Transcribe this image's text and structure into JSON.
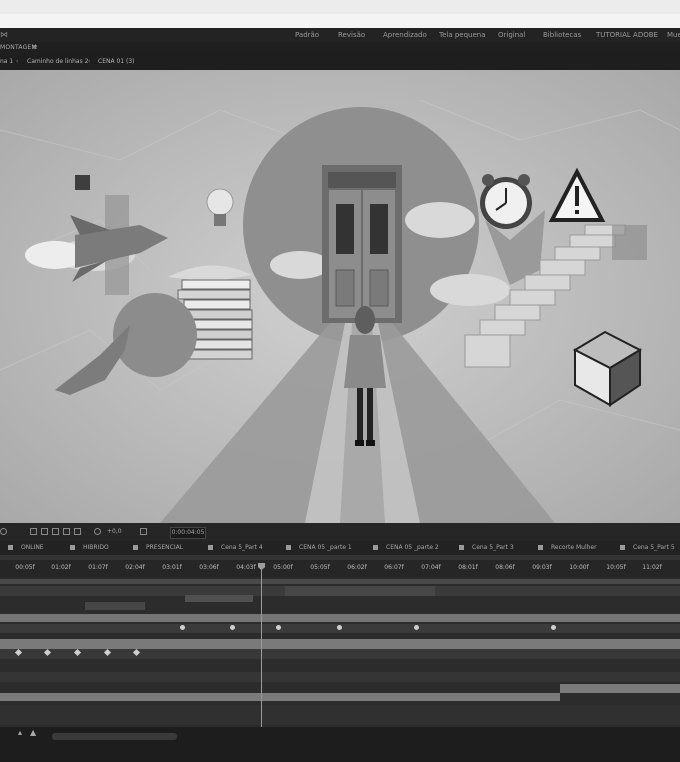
{
  "workspace": {
    "items": [
      "Padrão",
      "Revisão",
      "Aprendizado",
      "Tela pequena",
      "Original",
      "Bibliotecas",
      "TUTORIAL ADOBE",
      "Mue"
    ]
  },
  "panel": {
    "title": "MONTAGEM",
    "menu_icon": "hamburger-icon"
  },
  "breadcrumbs": [
    "na 1",
    "Caminho de linhas 2",
    "CENA 01 (3)"
  ],
  "viewer": {
    "scene": "collage-woman-walking-to-door"
  },
  "toolbar": {
    "exposure": "+0,0",
    "timecode": "0:00:04:05"
  },
  "tabs": [
    "ONLINE",
    "HIBRIDO",
    "PRESENCIAL",
    "Cena 5_Part 4",
    "CENA 05 _parte 1",
    "CENA 05 _parte 2",
    "Cena 5_Part 3",
    "Recorte Mulher",
    "Cena 5_Part 5"
  ],
  "ruler": {
    "ticks": [
      "00:05f",
      "01:02f",
      "01:07f",
      "02:04f",
      "03:01f",
      "03:06f",
      "04:03f",
      "05:00f",
      "05:05f",
      "06:02f",
      "06:07f",
      "07:04f",
      "08:01f",
      "08:06f",
      "09:03f",
      "10:00f",
      "10:05f",
      "11:02f"
    ]
  }
}
